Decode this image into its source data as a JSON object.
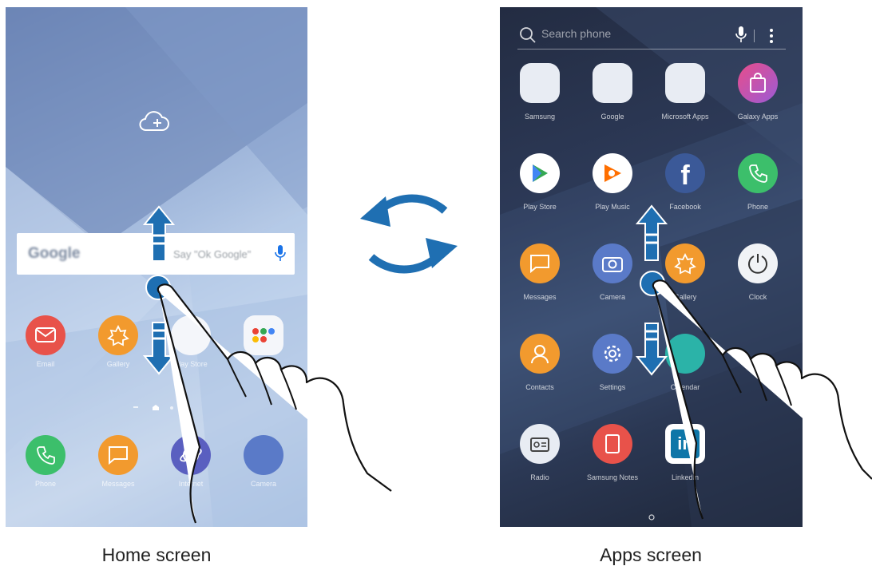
{
  "captions": {
    "home": "Home screen",
    "apps": "Apps screen"
  },
  "home": {
    "widget": {
      "logo": "Google",
      "hint": "Say \"Ok Google\""
    },
    "row1": [
      "Email",
      "Gallery",
      "Play Store",
      "Google"
    ],
    "dock": [
      "Phone",
      "Messages",
      "Internet",
      "Camera"
    ]
  },
  "apps": {
    "search_placeholder": "Search phone",
    "labels": [
      "Samsung",
      "Google",
      "Microsoft Apps",
      "Galaxy Apps",
      "Play Store",
      "Play Music",
      "Facebook",
      "Phone",
      "Messages",
      "Camera",
      "Gallery",
      "Clock",
      "Contacts",
      "Settings",
      "Calendar",
      "Radio",
      "Samsung Notes",
      "LinkedIn"
    ]
  },
  "colors": {
    "arrow_blue": "#1f6fb2",
    "accent": "#1565c0"
  }
}
